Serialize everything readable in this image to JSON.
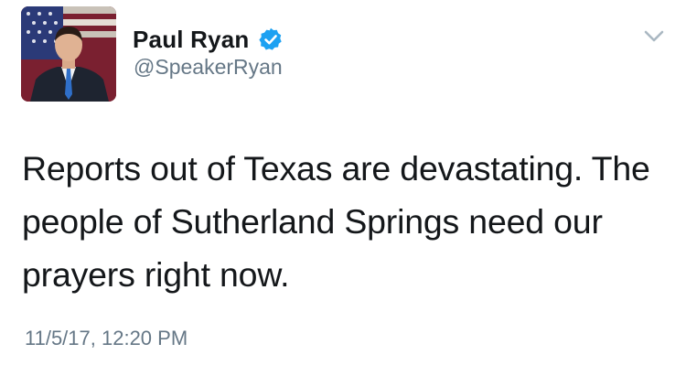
{
  "tweet": {
    "author": {
      "display_name": "Paul Ryan",
      "handle": "@SpeakerRyan",
      "verified": true,
      "avatar_icon": "profile-photo-avatar",
      "verified_icon": "verified-badge-icon"
    },
    "menu_icon": "chevron-down-icon",
    "text": "Reports out of Texas are devastating. The people of Sutherland Springs need our prayers right now.",
    "timestamp": "11/5/17, 12:20 PM"
  },
  "colors": {
    "text_primary": "#14171a",
    "text_secondary": "#657786",
    "verified_blue": "#1da1f2",
    "chevron": "#aab8c2"
  }
}
